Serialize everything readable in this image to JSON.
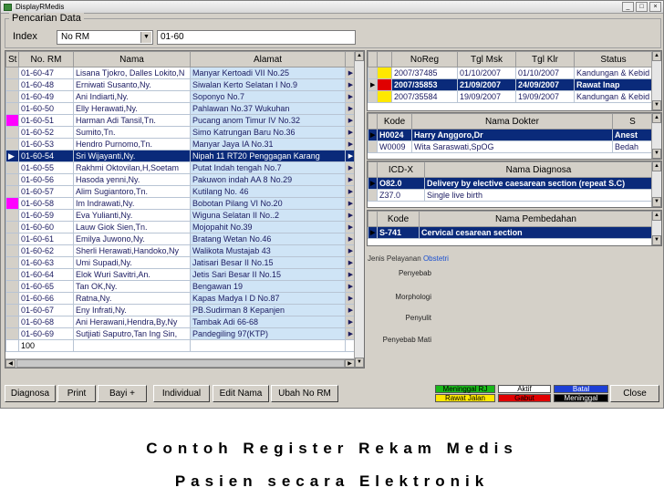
{
  "window": {
    "title": "DisplayRMedis"
  },
  "search": {
    "group_label": "Pencarian Data",
    "index_label": "Index",
    "index_value": "No RM",
    "query_value": "01-60"
  },
  "patients": {
    "columns": [
      "St",
      "No. RM",
      "Nama",
      "Alamat"
    ],
    "rows": [
      {
        "st": "",
        "rm": "01-60-47",
        "nama": "Lisana Tjokro, Dalles Lokito,N",
        "alamat": "Manyar Kertoadi VII No.25"
      },
      {
        "st": "",
        "rm": "01-60-48",
        "nama": "Erniwati Susanto,Ny.",
        "alamat": "Siwalan Kerto Selatan I No.9"
      },
      {
        "st": "",
        "rm": "01-60-49",
        "nama": "Ani Indiarti,Ny.",
        "alamat": "Soponyo No.7"
      },
      {
        "st": "",
        "rm": "01-60-50",
        "nama": "Elly Herawati,Ny.",
        "alamat": "Pahlawan No.37 Wukuhan"
      },
      {
        "st": "magenta",
        "rm": "01-60-51",
        "nama": "Harman Adi Tansil,Tn.",
        "alamat": "Pucang anom Timur IV No.32"
      },
      {
        "st": "",
        "rm": "01-60-52",
        "nama": "Sumito,Tn.",
        "alamat": "Simo Katrungan Baru No.36"
      },
      {
        "st": "",
        "rm": "01-60-53",
        "nama": "Hendro Purnomo,Tn.",
        "alamat": "Manyar Jaya IA No.31"
      },
      {
        "st": "selected",
        "rm": "01-60-54",
        "nama": "Sri Wijayanti,Ny.",
        "alamat": "Nipah 11 RT20 Penggagan Karang"
      },
      {
        "st": "",
        "rm": "01-60-55",
        "nama": "Rakhmi Oktovilan,H,Soetam",
        "alamat": "Putat Indah tengah No.7"
      },
      {
        "st": "",
        "rm": "01-60-56",
        "nama": "Hasoda yenni,Ny.",
        "alamat": "Pakuwon indah AA 8 No.29"
      },
      {
        "st": "",
        "rm": "01-60-57",
        "nama": "Alim Sugiantoro,Tn.",
        "alamat": "Kutilang No. 46"
      },
      {
        "st": "magenta",
        "rm": "01-60-58",
        "nama": "Im Indrawati,Ny.",
        "alamat": "Bobotan Pilang VI No.20"
      },
      {
        "st": "",
        "rm": "01-60-59",
        "nama": "Eva Yulianti,Ny.",
        "alamat": "Wiguna Selatan II No..2"
      },
      {
        "st": "",
        "rm": "01-60-60",
        "nama": "Lauw Giok Sien,Tn.",
        "alamat": "Mojopahit No.39"
      },
      {
        "st": "",
        "rm": "01-60-61",
        "nama": "Emilya Juwono,Ny.",
        "alamat": "Bratang Wetan No.46"
      },
      {
        "st": "",
        "rm": "01-60-62",
        "nama": "Sherli Herawati,Handoko,Ny",
        "alamat": "Walikota Mustajab 43"
      },
      {
        "st": "",
        "rm": "01-60-63",
        "nama": "Umi Supadi,Ny.",
        "alamat": "Jatisari Besar II No.15"
      },
      {
        "st": "",
        "rm": "01-60-64",
        "nama": "Elok Wuri Savitri,An.",
        "alamat": "Jetis Sari Besar II No.15"
      },
      {
        "st": "",
        "rm": "01-60-65",
        "nama": "Tan OK,Ny.",
        "alamat": "Bengawan 19"
      },
      {
        "st": "",
        "rm": "01-60-66",
        "nama": "Ratna,Ny.",
        "alamat": "Kapas Madya I D No.87"
      },
      {
        "st": "",
        "rm": "01-60-67",
        "nama": "Eny Infrati,Ny.",
        "alamat": "PB.Sudirman 8 Kepanjen"
      },
      {
        "st": "",
        "rm": "01-60-68",
        "nama": "Ani Herawani,Hendra,By,Ny",
        "alamat": "Tambak Adi 66-68"
      },
      {
        "st": "",
        "rm": "01-60-69",
        "nama": "Sutjiati Saputro,Tan Ing Sin,",
        "alamat": "Pandegiling 97(KTP)"
      }
    ],
    "footer_value": "100"
  },
  "registrations": {
    "columns": [
      "NoReg",
      "Tgl Msk",
      "Tgl Klr",
      "Status"
    ],
    "rows": [
      {
        "mark": "yellow",
        "noreg": "2007/37485",
        "masuk": "01/10/2007",
        "keluar": "01/10/2007",
        "status": "Kandungan & Kebid"
      },
      {
        "mark": "red",
        "noreg": "2007/35853",
        "masuk": "21/09/2007",
        "keluar": "24/09/2007",
        "status": "Rawat Inap"
      },
      {
        "mark": "yellow",
        "noreg": "2007/35584",
        "masuk": "19/09/2007",
        "keluar": "19/09/2007",
        "status": "Kandungan & Kebid"
      }
    ]
  },
  "doctors": {
    "columns": [
      "Kode",
      "Nama Dokter",
      "S"
    ],
    "rows": [
      {
        "kode": "H0024",
        "nama": "Harry Anggoro,Dr",
        "s": "Anest"
      },
      {
        "kode": "W0009",
        "nama": "Wita Saraswati,SpOG",
        "s": "Bedah"
      }
    ]
  },
  "diagnoses": {
    "columns": [
      "ICD-X",
      "Nama Diagnosa"
    ],
    "rows": [
      {
        "kode": "O82.0",
        "nama": "Delivery by elective caesarean section (repeat S.C)"
      },
      {
        "kode": "Z37.0",
        "nama": "Single live birth"
      }
    ]
  },
  "procedures": {
    "columns": [
      "Kode",
      "Nama Pembedahan"
    ],
    "rows": [
      {
        "kode": "S-741",
        "nama": "Cervical cesarean section"
      }
    ]
  },
  "details": {
    "jenis_label": "Jenis Pelayanan",
    "jenis_value": "Obstetri",
    "penyebab": "Penyebab",
    "morphologi": "Morphologi",
    "penyulit": "Penyulit",
    "penyebab_mati": "Penyebab Mati"
  },
  "buttons": {
    "diagnosa": "Diagnosa",
    "print": "Print",
    "bayi": "Bayi +",
    "individual": "Individual",
    "edit_nama": "Edit Nama",
    "ubah_no_rm": "Ubah No RM",
    "close": "Close"
  },
  "legend": {
    "meninggal_rj": "Meninggal RJ",
    "aktif": "Aktif",
    "batal": "Batal",
    "rawat_jalan": "Rawat Jalan",
    "gabut": "Gabut",
    "meninggal": "Meninggal",
    "colors": {
      "green": "#19b819",
      "white": "#ffffff",
      "blue": "#1d3fd6",
      "yellow": "#ffe800",
      "red": "#e00000",
      "black": "#000000"
    }
  },
  "caption": {
    "line1": "Contoh Register Rekam Medis",
    "line2": "Pasien secara Elektronik"
  }
}
